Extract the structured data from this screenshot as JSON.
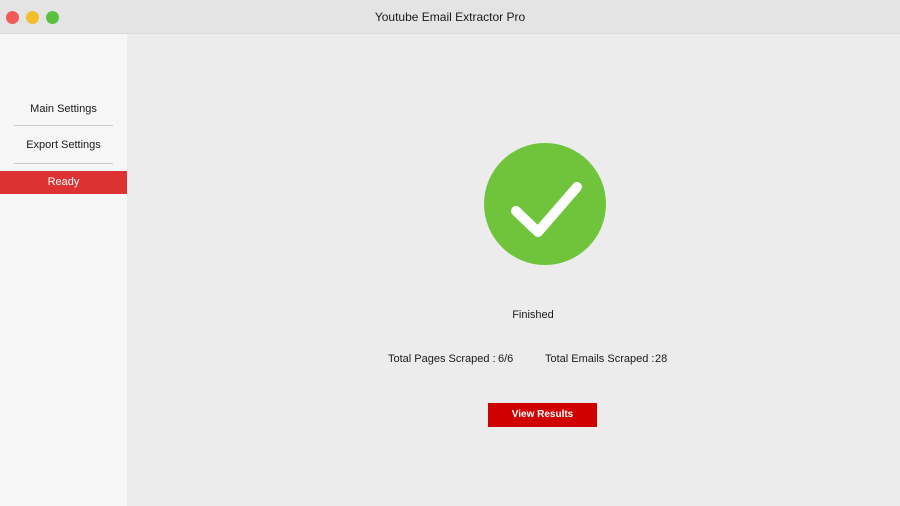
{
  "window": {
    "title": "Youtube Email Extractor Pro",
    "controls": [
      "close",
      "minimize",
      "zoom"
    ]
  },
  "sidebar": {
    "items": [
      {
        "label": "Main Settings"
      },
      {
        "label": "Export Settings"
      }
    ],
    "status_label": "Ready"
  },
  "main": {
    "status_icon": "checkmark-circle-icon",
    "status_text": "Finished",
    "stats": {
      "pages_label": "Total Pages Scraped :",
      "pages_value": "6/6",
      "emails_label": "Total Emails Scraped :",
      "emails_value": "28"
    },
    "view_results_label": "View Results"
  },
  "colors": {
    "accent_red": "#d10000",
    "status_red": "#dc3232",
    "success_green": "#6fc43c"
  }
}
